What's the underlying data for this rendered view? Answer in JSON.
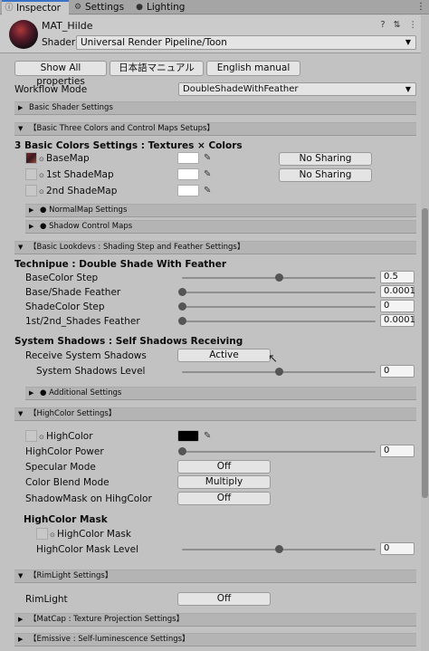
{
  "tabs": [
    {
      "label": "Inspector",
      "icon": "ⓘ"
    },
    {
      "label": "Settings",
      "icon": "⚙"
    },
    {
      "label": "Lighting",
      "icon": "●"
    }
  ],
  "tab_menu_icon": "⋮",
  "material": {
    "name": "MAT_Hilde",
    "shader_label": "Shader",
    "shader_value": "Universal Render Pipeline/Toon",
    "header_icons": "? ⇅ ⋮"
  },
  "top_buttons": {
    "show_all": "Show All properties",
    "manual_jp": "日本語マニュアル",
    "manual_en": "English manual"
  },
  "workflow": {
    "label": "Workflow Mode",
    "value": "DoubleShadeWithFeather"
  },
  "sections": {
    "basic_shader": "Basic Shader Settings",
    "three_colors": "【Basic Three Colors and Control Maps Setups】",
    "normalmap": "● NormalMap Settings",
    "shadow_control": "● Shadow Control Maps",
    "lookdevs": "【Basic Lookdevs : Shading Step and Feather Settings】",
    "additional": "● Additional Settings",
    "highcolor": "【HighColor Settings】",
    "rimlight": "【RimLight Settings】",
    "matcap": "【MatCap : Texture Projection Settings】",
    "emissive": "【Emissive : Self-luminescence Settings】"
  },
  "arrows": {
    "expanded": "▼",
    "collapsed": "▶"
  },
  "colors_title": "3 Basic Colors Settings : Textures × Colors",
  "texture_rows": [
    {
      "label": "BaseMap",
      "sharing": "No Sharing"
    },
    {
      "label": "1st ShadeMap",
      "sharing": "No Sharing"
    },
    {
      "label": "2nd ShadeMap"
    }
  ],
  "picker_glyph": "⊙",
  "eyedropper_glyph": "✎",
  "technique_title": "Technipue : Double Shade With Feather",
  "step_rows": [
    {
      "label": "BaseColor Step",
      "value": "0.5",
      "fraction": 0.5
    },
    {
      "label": "Base/Shade Feather",
      "value": "0.0001",
      "fraction": 0.0
    },
    {
      "label": "ShadeColor Step",
      "value": "0",
      "fraction": 0.0
    },
    {
      "label": "1st/2nd_Shades Feather",
      "value": "0.0001",
      "fraction": 0.0
    }
  ],
  "system_shadows": {
    "title": "System Shadows : Self Shadows Receiving",
    "receive_label": "Receive System Shadows",
    "receive_value": "Active",
    "level_label": "System Shadows Level",
    "level_value": "0",
    "level_fraction": 0.5
  },
  "highcolor": {
    "label": "HighColor",
    "power_label": "HighColor Power",
    "power_value": "0",
    "power_fraction": 0.0,
    "specular_label": "Specular Mode",
    "specular_value": "Off",
    "blend_label": "Color Blend Mode",
    "blend_value": "Multiply",
    "shadowmask_label": "ShadowMask on HihgColor",
    "shadowmask_value": "Off",
    "mask_title": "HighColor Mask",
    "mask_label": "HighColor Mask",
    "mask_level_label": "HighColor Mask Level",
    "mask_level_value": "0",
    "mask_level_fraction": 0.5
  },
  "rimlight": {
    "label": "RimLight",
    "value": "Off"
  },
  "cursor_glyph": "↖",
  "colors": {
    "background": "#c2c2c2",
    "tab_active_accent": "#3a72c8",
    "section_header": "#b4b4b4",
    "button": "#e4e4e4",
    "highcolor_swatch": "#000000"
  }
}
